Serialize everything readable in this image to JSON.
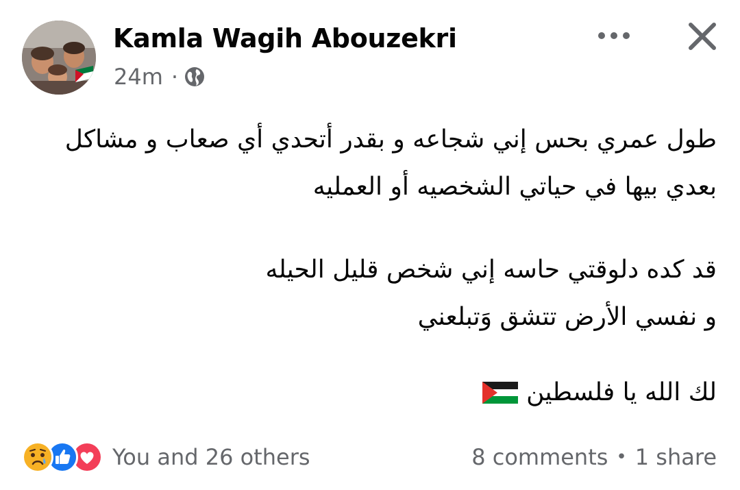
{
  "post": {
    "author": "Kamla Wagih Abouzekri",
    "time": "24m",
    "separator": "·",
    "privacy_icon": "globe-icon",
    "more_icon": "more-options-icon",
    "close_icon": "close-icon",
    "text_lines": [
      "طول عمري بحس إني شجاعه و بقدر أتحدي أي صعاب و مشاكل",
      "بعدي بيها في حياتي الشخصيه أو العمليه",
      "قد كده دلوقتي حاسه إني شخص قليل الحيله",
      "و نفسي الأرض تتشق وَتبلعني",
      "لك الله يا فلسطين"
    ],
    "emoji": "palestine-flag"
  },
  "footer": {
    "reaction_icons": [
      "sad-reaction-icon",
      "like-reaction-icon",
      "love-reaction-icon"
    ],
    "reactions_text": "You and 26 others",
    "comments": "8 comments",
    "dot": "•",
    "shares": "1 share"
  },
  "colors": {
    "text": "#050505",
    "secondary": "#65676b",
    "like_blue": "#1877f2",
    "love_red": "#f33e58",
    "sad_yellow": "#f7b125"
  }
}
